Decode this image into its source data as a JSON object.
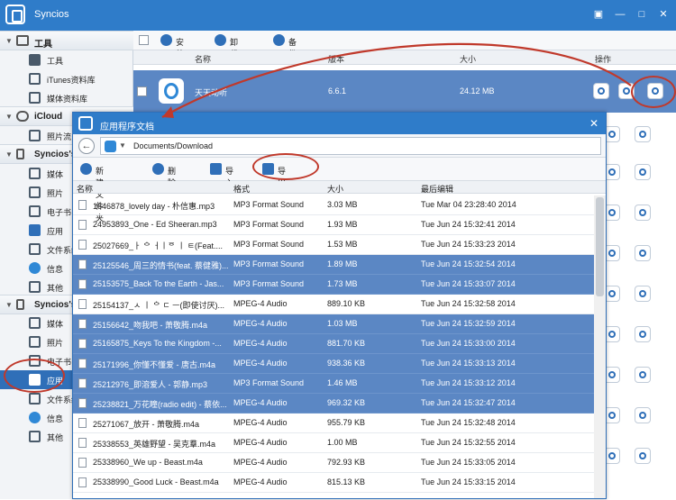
{
  "app": {
    "title": "Syncios"
  },
  "window_controls": [
    {
      "name": "menu-icon",
      "glyph": "▣"
    },
    {
      "name": "minimize-icon",
      "glyph": "—"
    },
    {
      "name": "maximize-icon",
      "glyph": "□"
    },
    {
      "name": "close-icon",
      "glyph": "✕"
    }
  ],
  "sidebar": {
    "sections": [
      {
        "label": "工具",
        "items": [
          {
            "label": "工具"
          },
          {
            "label": "iTunes资料库"
          },
          {
            "label": "媒体资料库"
          }
        ]
      },
      {
        "label": "iCloud",
        "items": [
          {
            "label": "照片流"
          }
        ]
      },
      {
        "label": "Syncios's",
        "items": [
          {
            "label": "媒体"
          },
          {
            "label": "照片"
          },
          {
            "label": "电子书"
          },
          {
            "label": "应用"
          },
          {
            "label": "文件系统"
          },
          {
            "label": "信息"
          },
          {
            "label": "其他"
          }
        ]
      },
      {
        "label": "Syncios's",
        "items": [
          {
            "label": "媒体"
          },
          {
            "label": "照片"
          },
          {
            "label": "电子书"
          },
          {
            "label": "应用"
          },
          {
            "label": "文件系统"
          },
          {
            "label": "信息"
          },
          {
            "label": "其他"
          }
        ]
      }
    ]
  },
  "main": {
    "toolbar": {
      "install": "安装",
      "uninstall": "卸载",
      "backup": "备份"
    },
    "headers": {
      "name": "名称",
      "version": "版本",
      "size": "大小",
      "action": "操作"
    },
    "app_row": {
      "name": "天天动听",
      "version": "6.6.1",
      "size": "24.12 MB"
    }
  },
  "dialog": {
    "title": "应用程序文档",
    "path": "Documents/Download",
    "toolbar": {
      "new_folder": "新建文件夹",
      "delete": "删除",
      "import": "导入",
      "export": "导出"
    },
    "headers": {
      "name": "名称",
      "format": "格式",
      "size": "大小",
      "modified": "最后编辑"
    },
    "files": [
      {
        "name": "1646878_lovely day - 朴信惠.mp3",
        "format": "MP3 Format Sound",
        "size": "3.03 MB",
        "modified": "Tue Mar 04 23:28:40 2014",
        "selected": false
      },
      {
        "name": "24953893_One - Ed Sheeran.mp3",
        "format": "MP3 Format Sound",
        "size": "1.93 MB",
        "modified": "Tue Jun 24 15:32:41 2014",
        "selected": false
      },
      {
        "name": "25027669_ㅏ ᅌ ㅓㅣᅙ ㅣ ㅌ(Feat....",
        "format": "MP3 Format Sound",
        "size": "1.53 MB",
        "modified": "Tue Jun 24 15:33:23 2014",
        "selected": false
      },
      {
        "name": "25125546_周三的情书(feat. 蔡健雅)...",
        "format": "MP3 Format Sound",
        "size": "1.89 MB",
        "modified": "Tue Jun 24 15:32:54 2014",
        "selected": true
      },
      {
        "name": "25153575_Back To the Earth - Jas...",
        "format": "MP3 Format Sound",
        "size": "1.73 MB",
        "modified": "Tue Jun 24 15:33:07 2014",
        "selected": true
      },
      {
        "name": "25154137_ㅅ ㅣ ᅌ ㄷ ㅡ(即使讨厌)...",
        "format": "MPEG-4 Audio",
        "size": "889.10 KB",
        "modified": "Tue Jun 24 15:32:58 2014",
        "selected": false
      },
      {
        "name": "25156642_吻我吧 - 萧敬腾.m4a",
        "format": "MPEG-4 Audio",
        "size": "1.03 MB",
        "modified": "Tue Jun 24 15:32:59 2014",
        "selected": true
      },
      {
        "name": "25165875_Keys To the Kingdom -...",
        "format": "MPEG-4 Audio",
        "size": "881.70 KB",
        "modified": "Tue Jun 24 15:33:00 2014",
        "selected": true
      },
      {
        "name": "25171996_你懂不懂爱 - 唐古.m4a",
        "format": "MPEG-4 Audio",
        "size": "938.36 KB",
        "modified": "Tue Jun 24 15:33:13 2014",
        "selected": true
      },
      {
        "name": "25212976_即溶爱人 - 郭静.mp3",
        "format": "MP3 Format Sound",
        "size": "1.46 MB",
        "modified": "Tue Jun 24 15:33:12 2014",
        "selected": true
      },
      {
        "name": "25238821_万花瞳(radio edit) - 蔡依...",
        "format": "MPEG-4 Audio",
        "size": "969.32 KB",
        "modified": "Tue Jun 24 15:32:47 2014",
        "selected": true
      },
      {
        "name": "25271067_放开 - 萧敬腾.m4a",
        "format": "MPEG-4 Audio",
        "size": "955.79 KB",
        "modified": "Tue Jun 24 15:32:48 2014",
        "selected": false
      },
      {
        "name": "25338553_英雄野望 - 吴克羣.m4a",
        "format": "MPEG-4 Audio",
        "size": "1.00 MB",
        "modified": "Tue Jun 24 15:32:55 2014",
        "selected": false
      },
      {
        "name": "25338960_We up - Beast.m4a",
        "format": "MPEG-4 Audio",
        "size": "792.93 KB",
        "modified": "Tue Jun 24 15:33:05 2014",
        "selected": false
      },
      {
        "name": "25338990_Good Luck - Beast.m4a",
        "format": "MPEG-4 Audio",
        "size": "815.13 KB",
        "modified": "Tue Jun 24 15:33:15 2014",
        "selected": false
      }
    ]
  },
  "colors": {
    "accent": "#2f7cc9",
    "selection": "#5b87c4",
    "annotation": "#c0392b"
  }
}
